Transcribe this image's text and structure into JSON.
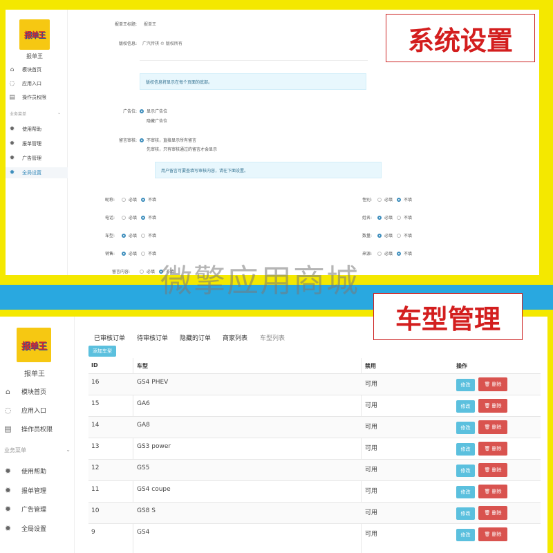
{
  "top": {
    "stamp": "系统设置",
    "shop_name": "报单王",
    "logo_text": "报单王",
    "menu": [
      {
        "label": "模块首页",
        "icon": "home-icon"
      },
      {
        "label": "应用入口",
        "icon": "chat-icon"
      },
      {
        "label": "操作员权限",
        "icon": "document-icon"
      }
    ],
    "group_label": "业务菜单",
    "menu2": [
      {
        "label": "使用帮助",
        "icon": "gear-icon"
      },
      {
        "label": "报单管理",
        "icon": "gear-icon"
      },
      {
        "label": "广告管理",
        "icon": "gear-icon"
      },
      {
        "label": "全局设置",
        "icon": "gear-icon"
      }
    ],
    "form": {
      "title_label": "报单王标题:",
      "title_value": "报单王",
      "copyright_label": "版权信息:",
      "copyright_value": "广汽传祺 © 版权所有",
      "copyright_tip": "版权信息将显示在每个页面的底部。",
      "ad_label": "广告位:",
      "ad_opt1": "显示广告位",
      "ad_opt2": "隐藏广告位",
      "review_label": "留言审核:",
      "review_opt1": "不审核，直接显示所有留言",
      "review_opt2": "先审核，只有审核通过的留言才会显示",
      "review_tip": "用户留言可要查填写审核内容，请在下面设置。",
      "fields_left": [
        {
          "label": "昵称:",
          "opt1": "必填",
          "opt2": "不填",
          "selected": 2
        },
        {
          "label": "电话:",
          "opt1": "必填",
          "opt2": "不填",
          "selected": 2
        },
        {
          "label": "车型:",
          "opt1": "必填",
          "opt2": "不填",
          "selected": 1
        },
        {
          "label": "销售:",
          "opt1": "必填",
          "opt2": "不填",
          "selected": 1
        },
        {
          "label": "留言内容:",
          "opt1": "必填",
          "opt2": "不填",
          "selected": 2
        }
      ],
      "fields_right": [
        {
          "label": "性别:",
          "opt1": "必填",
          "opt2": "不填",
          "selected": 2
        },
        {
          "label": "姓名:",
          "opt1": "必填",
          "opt2": "不填",
          "selected": 1
        },
        {
          "label": "数量:",
          "opt1": "必填",
          "opt2": "不填",
          "selected": 1
        },
        {
          "label": "来源:",
          "opt1": "必填",
          "opt2": "不填",
          "selected": 2
        }
      ]
    }
  },
  "watermark": "微擎应用商城",
  "bottom": {
    "stamp": "车型管理",
    "shop_name": "报单王",
    "logo_text": "报单王",
    "menu": [
      {
        "label": "模块首页",
        "icon": "home-icon"
      },
      {
        "label": "应用入口",
        "icon": "chat-icon"
      },
      {
        "label": "操作员权限",
        "icon": "document-icon"
      }
    ],
    "group_label": "业务菜单",
    "menu2": [
      {
        "label": "使用帮助",
        "icon": "gear-icon"
      },
      {
        "label": "报单管理",
        "icon": "gear-icon"
      },
      {
        "label": "广告管理",
        "icon": "gear-icon"
      },
      {
        "label": "全局设置",
        "icon": "gear-icon"
      }
    ],
    "tabs": [
      "已审核订单",
      "待审核订单",
      "隐藏的订单",
      "商家列表",
      "车型列表"
    ],
    "add_button": "添加车型",
    "columns": [
      "ID",
      "车型",
      "禁用",
      "操作"
    ],
    "edit_label": "修改",
    "delete_label": "删除",
    "rows": [
      {
        "id": "16",
        "model": "GS4 PHEV",
        "status": "可用"
      },
      {
        "id": "15",
        "model": "GA6",
        "status": "可用"
      },
      {
        "id": "14",
        "model": "GA8",
        "status": "可用"
      },
      {
        "id": "13",
        "model": "GS3 power",
        "status": "可用"
      },
      {
        "id": "12",
        "model": "GS5",
        "status": "可用"
      },
      {
        "id": "11",
        "model": "GS4 coupe",
        "status": "可用"
      },
      {
        "id": "10",
        "model": "GS8 S",
        "status": "可用"
      },
      {
        "id": "9",
        "model": "GS4",
        "status": "可用"
      }
    ]
  }
}
